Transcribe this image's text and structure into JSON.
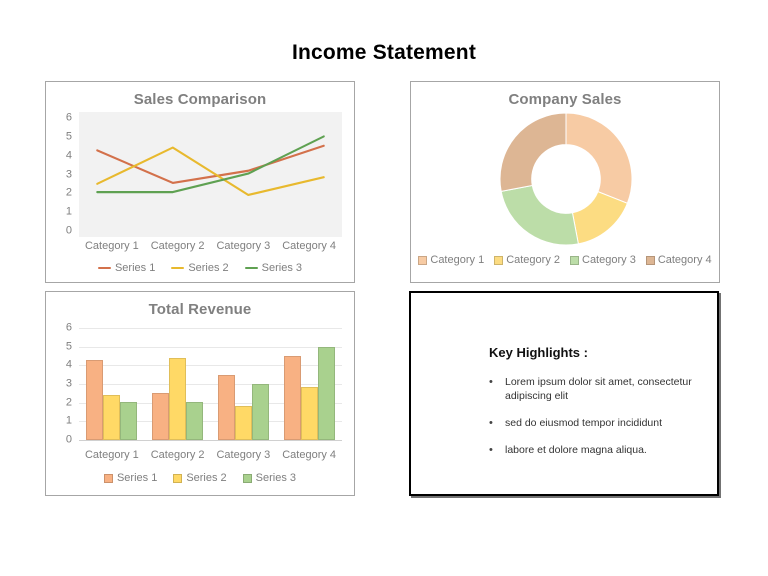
{
  "slide": {
    "title": "Income Statement",
    "background_color": "#FFFFFF"
  },
  "palette": {
    "series1_line": "#D3714B",
    "series2_line": "#E8B92E",
    "series3_line": "#5FA152",
    "series1_fill": "#F8B183",
    "series2_fill": "#FFD966",
    "series3_fill": "#A9D18E",
    "donut_cat1": "#F7CBA4",
    "donut_cat2": "#FCDC82",
    "donut_cat3": "#BCDDA8",
    "donut_cat4": "#DDB694",
    "title_gray": "#808080",
    "axis_gray": "#7F7F7F",
    "panel_border": "#A6A6A6",
    "notes_border": "#000000"
  },
  "panels": {
    "line": {
      "name": "Sales Comparison"
    },
    "donut": {
      "name": "Company Sales"
    },
    "bar": {
      "name": "Total Revenue"
    },
    "notes": {
      "name": "Key Highlights"
    }
  },
  "notes": {
    "heading": "Key Highlights :",
    "bullet_glyph": "•",
    "items": [
      "Lorem ipsum dolor sit amet, consectetur adipiscing elit",
      "sed do eiusmod tempor incididunt",
      "labore et dolore magna aliqua."
    ]
  },
  "chart_data": [
    {
      "id": "sales-comparison",
      "type": "line",
      "title": "Sales Comparison",
      "xlabel": "",
      "ylabel": "",
      "ylim": [
        0,
        6
      ],
      "yticks": [
        6,
        5,
        4,
        3,
        2,
        1,
        0
      ],
      "grid": true,
      "legend_position": "bottom",
      "categories": [
        "Category 1",
        "Category 2",
        "Category 3",
        "Category 4"
      ],
      "series": [
        {
          "name": "Series 1",
          "color": "#D3714B",
          "values": [
            4.3,
            2.55,
            3.2,
            4.55
          ]
        },
        {
          "name": "Series 2",
          "color": "#E8B92E",
          "values": [
            2.5,
            4.45,
            1.9,
            2.85
          ]
        },
        {
          "name": "Series 3",
          "color": "#5FA152",
          "values": [
            2.05,
            2.05,
            3.05,
            5.05
          ]
        }
      ]
    },
    {
      "id": "company-sales",
      "type": "pie",
      "variant": "donut",
      "title": "Company Sales",
      "legend_position": "bottom",
      "inner_radius_ratio": 0.52,
      "start_angle_deg": 0,
      "labels": [
        "Category 1",
        "Category 2",
        "Category 3",
        "Category 4"
      ],
      "values": [
        31,
        16,
        25,
        28
      ],
      "percent": [
        31,
        16,
        25,
        28
      ],
      "colors": [
        "#F7CBA4",
        "#FCDC82",
        "#BCDDA8",
        "#DDB694"
      ]
    },
    {
      "id": "total-revenue",
      "type": "bar",
      "title": "Total Revenue",
      "xlabel": "",
      "ylabel": "",
      "ylim": [
        0,
        6
      ],
      "yticks": [
        6,
        5,
        4,
        3,
        2,
        1,
        0
      ],
      "grid": true,
      "legend_position": "bottom",
      "categories": [
        "Category 1",
        "Category 2",
        "Category 3",
        "Category 4"
      ],
      "series": [
        {
          "name": "Series 1",
          "color": "#F8B183",
          "values": [
            4.3,
            2.5,
            3.5,
            4.5
          ]
        },
        {
          "name": "Series 2",
          "color": "#FFD966",
          "values": [
            2.4,
            4.4,
            1.8,
            2.85
          ]
        },
        {
          "name": "Series 3",
          "color": "#A9D18E",
          "values": [
            2.05,
            2.05,
            3.0,
            5.0
          ]
        }
      ]
    }
  ]
}
